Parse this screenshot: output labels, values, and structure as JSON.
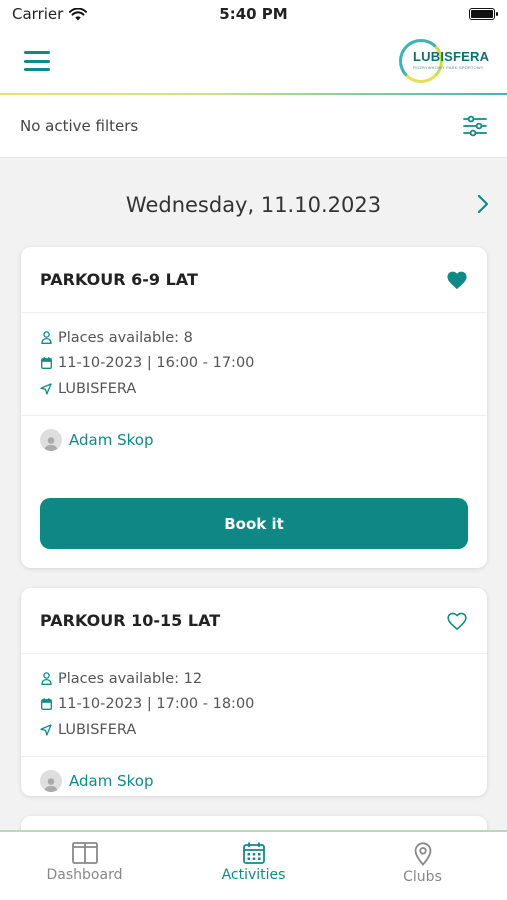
{
  "status_bar": {
    "carrier": "Carrier",
    "time": "5:40 PM"
  },
  "header": {
    "logo_text": "LUBISFERA",
    "logo_sub": "ROZRYWKOWY PARK SPORTOWY"
  },
  "filters": {
    "text": "No active filters"
  },
  "date": {
    "label": "Wednesday, 11.10.2023"
  },
  "activities": [
    {
      "title": "PARKOUR 6-9 LAT",
      "favorite": true,
      "places": "Places available: 8",
      "datetime": "11-10-2023 | 16:00 - 17:00",
      "location": "LUBISFERA",
      "trainer": "Adam Skop",
      "book_label": "Book it"
    },
    {
      "title": "PARKOUR 10-15 LAT",
      "favorite": false,
      "places": "Places available: 12",
      "datetime": "11-10-2023 | 17:00 - 18:00",
      "location": "LUBISFERA",
      "trainer": "Adam Skop"
    }
  ],
  "nav": {
    "items": [
      {
        "label": "Dashboard",
        "icon": "dashboard-icon"
      },
      {
        "label": "Activities",
        "icon": "calendar-icon",
        "active": true
      },
      {
        "label": "Clubs",
        "icon": "location-pin-icon"
      }
    ]
  },
  "colors": {
    "accent": "#0f8a87",
    "button": "#0f8784"
  }
}
